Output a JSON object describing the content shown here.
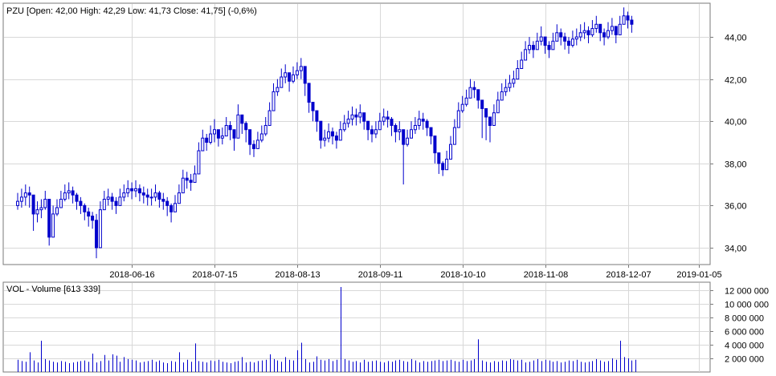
{
  "price_header": "PZU [Open: 42,00  High: 42,29  Low: 41,73  Close: 41,75] (-0,6%)",
  "volume_header": "VOL - Volume [613 339]",
  "colors": {
    "candle": "#0000cc",
    "grid": "#d8d8d8",
    "frame": "#7a7a7a",
    "background": "#ffffff"
  },
  "chart_data": [
    {
      "type": "candlestick",
      "ticker": "PZU",
      "y_ticks": [
        "34,00",
        "36,00",
        "38,00",
        "40,00",
        "42,00",
        "44,00"
      ],
      "y_tick_values": [
        34,
        36,
        38,
        40,
        42,
        44
      ],
      "ylim": [
        33.2,
        45.6
      ],
      "x_tick_labels": [
        "2018-06-16",
        "2018-07-15",
        "2018-08-13",
        "2018-09-11",
        "2018-10-10",
        "2018-11-08",
        "2018-12-07",
        "2019-01-05"
      ],
      "x_tick_sessions": [
        29,
        50,
        71,
        92,
        113,
        134,
        155,
        173
      ],
      "grid": true,
      "approx_close": [
        36.2,
        36.4,
        36.6,
        36.5,
        35.6,
        35.8,
        35.9,
        36.3,
        34.5,
        35.6,
        35.9,
        36.3,
        36.6,
        36.7,
        36.5,
        36.2,
        36.0,
        35.7,
        35.5,
        35.3,
        34.0,
        35.8,
        36.3,
        36.4,
        36.2,
        36.0,
        36.4,
        36.6,
        36.8,
        36.7,
        36.8,
        36.6,
        36.5,
        36.4,
        36.4,
        36.6,
        36.3,
        36.2,
        36.0,
        35.7,
        36.1,
        36.6,
        37.3,
        37.2,
        37.1,
        37.5,
        38.6,
        39.2,
        39.0,
        39.4,
        39.6,
        39.2,
        39.3,
        39.8,
        39.6,
        39.2,
        40.3,
        39.9,
        39.6,
        38.9,
        38.7,
        39.1,
        39.4,
        39.8,
        40.5,
        41.4,
        41.6,
        42.1,
        42.3,
        41.9,
        42.2,
        42.4,
        42.6,
        41.8,
        40.9,
        40.5,
        40.0,
        39.1,
        39.2,
        39.5,
        39.3,
        39.1,
        39.6,
        39.9,
        40.1,
        40.3,
        40.2,
        40.4,
        40.0,
        39.6,
        39.4,
        39.6,
        40.0,
        40.2,
        40.1,
        39.8,
        39.5,
        39.6,
        38.9,
        39.2,
        39.6,
        39.8,
        40.1,
        40.0,
        39.7,
        39.3,
        38.5,
        38.0,
        37.7,
        38.2,
        38.9,
        39.7,
        40.5,
        40.8,
        41.1,
        41.6,
        41.5,
        41.0,
        40.6,
        40.2,
        39.8,
        40.4,
        41.0,
        41.4,
        41.6,
        41.8,
        42.0,
        42.5,
        42.9,
        43.4,
        43.6,
        43.4,
        43.8,
        44.0,
        43.6,
        43.4,
        43.8,
        44.2,
        44.0,
        43.8,
        43.6,
        43.9,
        44.0,
        44.2,
        44.3,
        44.1,
        44.4,
        44.6,
        44.2,
        44.0,
        44.3,
        44.5,
        44.1,
        44.6,
        45.0,
        44.8,
        44.6
      ],
      "approx_low": [
        35.8,
        35.9,
        36.0,
        35.9,
        34.8,
        35.2,
        35.4,
        35.8,
        34.1,
        35.2,
        35.5,
        35.9,
        36.2,
        36.3,
        36.1,
        35.8,
        35.6,
        35.3,
        35.0,
        34.9,
        33.5,
        35.2,
        35.9,
        36.0,
        35.8,
        35.6,
        36.0,
        36.2,
        36.4,
        36.3,
        36.4,
        36.2,
        36.1,
        36.0,
        36.0,
        36.2,
        35.9,
        35.8,
        35.5,
        35.2,
        35.7,
        36.2,
        36.8,
        36.8,
        36.7,
        37.1,
        38.0,
        38.7,
        38.6,
        38.9,
        39.0,
        38.8,
        38.9,
        39.4,
        39.1,
        38.6,
        39.8,
        39.4,
        39.0,
        38.4,
        38.3,
        38.7,
        39.0,
        39.3,
        40.0,
        40.9,
        41.2,
        41.6,
        41.8,
        41.4,
        41.8,
        42.0,
        42.0,
        41.2,
        40.4,
        40.0,
        39.5,
        38.7,
        38.8,
        39.0,
        38.9,
        38.7,
        39.2,
        39.5,
        39.7,
        39.8,
        39.8,
        39.9,
        39.6,
        39.1,
        39.0,
        39.2,
        39.6,
        39.8,
        39.7,
        39.3,
        39.0,
        39.1,
        37.0,
        38.8,
        39.2,
        39.4,
        39.6,
        39.6,
        39.3,
        38.9,
        38.0,
        37.5,
        37.4,
        37.8,
        38.5,
        39.3,
        40.1,
        40.4,
        40.7,
        41.2,
        41.1,
        40.6,
        39.2,
        39.1,
        39.0,
        40.0,
        40.6,
        41.0,
        41.2,
        41.4,
        41.6,
        42.1,
        42.5,
        43.0,
        43.2,
        43.0,
        43.4,
        43.6,
        43.2,
        43.0,
        43.4,
        43.8,
        43.6,
        43.4,
        43.2,
        43.5,
        43.6,
        43.8,
        43.9,
        43.7,
        44.0,
        44.2,
        43.8,
        43.6,
        43.9,
        44.1,
        43.7,
        44.2,
        44.6,
        44.4,
        44.2
      ],
      "approx_high": [
        36.6,
        36.8,
        37.0,
        36.9,
        36.0,
        36.2,
        36.3,
        36.7,
        35.9,
        36.0,
        36.3,
        36.7,
        37.0,
        37.1,
        36.9,
        36.6,
        36.4,
        36.1,
        35.9,
        35.7,
        35.6,
        36.2,
        36.7,
        36.8,
        36.6,
        36.4,
        36.8,
        37.0,
        37.2,
        37.1,
        37.2,
        37.0,
        36.9,
        36.8,
        36.8,
        37.0,
        36.7,
        36.6,
        36.4,
        36.1,
        36.5,
        37.0,
        37.7,
        37.6,
        37.5,
        37.9,
        39.0,
        39.6,
        39.4,
        39.8,
        40.1,
        39.6,
        39.7,
        40.2,
        40.0,
        39.6,
        40.8,
        40.3,
        40.0,
        39.3,
        39.1,
        39.5,
        39.8,
        40.2,
        40.9,
        41.8,
        42.0,
        42.5,
        42.7,
        42.3,
        42.6,
        42.8,
        43.0,
        42.2,
        41.3,
        40.9,
        40.4,
        39.5,
        39.6,
        39.9,
        39.7,
        39.5,
        40.0,
        40.3,
        40.5,
        40.7,
        40.6,
        40.8,
        40.4,
        40.0,
        39.8,
        40.0,
        40.4,
        40.6,
        40.5,
        40.2,
        39.9,
        40.0,
        39.3,
        39.6,
        40.0,
        40.2,
        40.5,
        40.4,
        40.1,
        39.7,
        38.9,
        38.4,
        38.1,
        38.6,
        39.3,
        40.1,
        40.9,
        41.2,
        41.5,
        42.0,
        41.9,
        41.4,
        41.0,
        40.6,
        40.2,
        40.8,
        41.4,
        41.8,
        42.0,
        42.2,
        42.4,
        42.9,
        43.3,
        43.8,
        44.0,
        43.8,
        44.2,
        44.5,
        44.0,
        43.8,
        44.2,
        44.6,
        44.4,
        44.2,
        44.0,
        44.3,
        44.4,
        44.6,
        44.7,
        44.5,
        44.8,
        45.0,
        44.6,
        44.4,
        44.7,
        44.9,
        44.5,
        45.0,
        45.4,
        45.2,
        45.0
      ]
    },
    {
      "type": "bar",
      "series_name": "VOL",
      "y_ticks": [
        "2 000 000",
        "4 000 000",
        "6 000 000",
        "8 000 000",
        "10 000 000",
        "12 000 000"
      ],
      "y_tick_values": [
        2000000,
        4000000,
        6000000,
        8000000,
        10000000,
        12000000
      ],
      "ylim": [
        0,
        13200000
      ],
      "grid": true,
      "approx_volume": [
        1800000,
        1600000,
        1500000,
        2900000,
        1700000,
        1400000,
        4600000,
        1900000,
        1700000,
        1500000,
        1400000,
        1600000,
        1500000,
        1300000,
        1400000,
        1500000,
        1600000,
        1700000,
        1500000,
        2700000,
        1400000,
        1600000,
        2500000,
        1700000,
        2600000,
        2400000,
        1500000,
        2200000,
        1900000,
        1800000,
        1700000,
        1400000,
        1500000,
        1600000,
        1800000,
        1500000,
        1700000,
        1400000,
        1300000,
        1600000,
        1500000,
        2900000,
        1400000,
        1800000,
        1500000,
        4200000,
        1600000,
        1500000,
        1400000,
        1700000,
        1600000,
        1800000,
        1500000,
        1400000,
        1300000,
        1500000,
        1600000,
        2200000,
        1400000,
        1500000,
        1400000,
        1600000,
        1700000,
        1800000,
        2600000,
        1900000,
        1700000,
        1500000,
        2200000,
        1800000,
        1700000,
        3200000,
        4300000,
        1900000,
        1400000,
        1500000,
        2300000,
        1800000,
        1700000,
        1900000,
        1600000,
        1800000,
        12500000,
        1900000,
        1700000,
        1500000,
        1600000,
        1400000,
        1800000,
        1500000,
        1600000,
        1700000,
        1500000,
        1400000,
        1600000,
        1500000,
        1700000,
        1800000,
        1600000,
        1500000,
        1900000,
        1700000,
        1400000,
        1600000,
        1500000,
        1600000,
        1700000,
        1800000,
        1600000,
        1700000,
        1800000,
        1600000,
        1500000,
        1800000,
        1600000,
        1700000,
        1900000,
        4800000,
        1700000,
        1500000,
        1400000,
        1600000,
        1500000,
        1700000,
        1600000,
        1900000,
        1800000,
        1700000,
        1800000,
        1400000,
        1500000,
        1700000,
        1900000,
        1600000,
        1800000,
        1700000,
        1500000,
        1600000,
        1400000,
        1500000,
        1700000,
        1600000,
        1800000,
        1500000,
        1400000,
        1500000,
        1600000,
        1900000,
        1700000,
        1500000,
        1600000,
        2000000,
        1800000,
        4600000,
        2200000,
        2000000,
        1700000,
        1800000
      ]
    }
  ]
}
